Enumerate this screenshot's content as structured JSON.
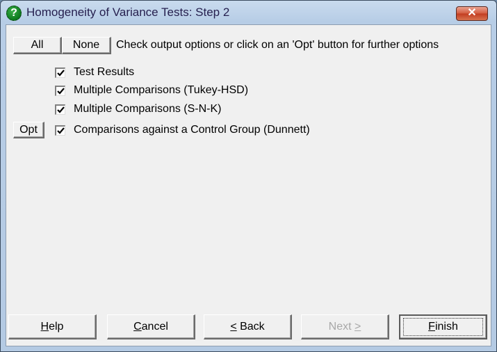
{
  "window": {
    "title": "Homogeneity of Variance Tests: Step 2",
    "app_icon": "help-question-icon",
    "close_icon": "close-x-icon",
    "close_glyph": "✕"
  },
  "toolbar": {
    "all_label": "All",
    "none_label": "None",
    "instruction": "Check output options or click on an 'Opt' button for further options"
  },
  "options": [
    {
      "label": "Test Results",
      "checked": true,
      "has_opt": false
    },
    {
      "label": "Multiple Comparisons (Tukey-HSD)",
      "checked": true,
      "has_opt": false
    },
    {
      "label": "Multiple Comparisons (S-N-K)",
      "checked": true,
      "has_opt": false
    },
    {
      "label": "Comparisons against a Control Group (Dunnett)",
      "checked": true,
      "has_opt": true
    }
  ],
  "opt_button_label": "Opt",
  "footer": {
    "help": {
      "mnemonic": "H",
      "rest": "elp"
    },
    "cancel": {
      "mnemonic": "C",
      "rest": "ancel"
    },
    "back": {
      "mnemonic": "<",
      "rest": " Back"
    },
    "next": {
      "pre": "Next ",
      "mnemonic": ">",
      "enabled": false
    },
    "finish": {
      "mnemonic": "F",
      "rest": "inish",
      "default": true
    }
  }
}
